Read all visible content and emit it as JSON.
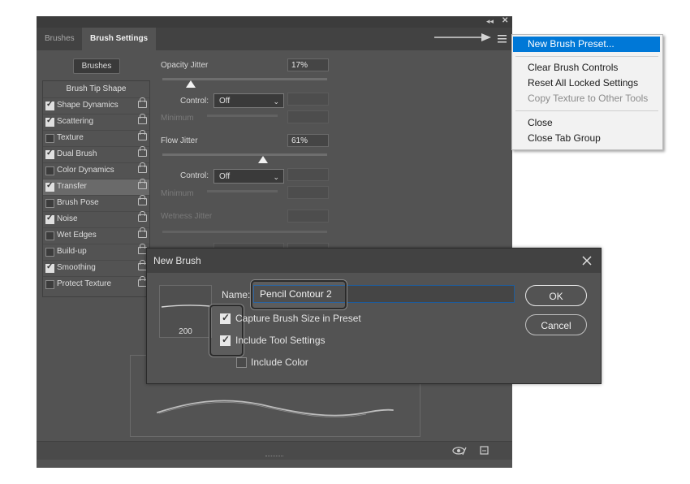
{
  "panel": {
    "tabs": [
      {
        "label": "Brushes"
      },
      {
        "label": "Brush Settings"
      }
    ],
    "brushes_button": "Brushes",
    "tip_shape_label": "Brush Tip Shape",
    "list_items": [
      {
        "label": "Shape Dynamics",
        "checked": true
      },
      {
        "label": "Scattering",
        "checked": true
      },
      {
        "label": "Texture",
        "checked": false
      },
      {
        "label": "Dual Brush",
        "checked": true
      },
      {
        "label": "Color Dynamics",
        "checked": false
      },
      {
        "label": "Transfer",
        "checked": true,
        "selected": true
      },
      {
        "label": "Brush Pose",
        "checked": false
      },
      {
        "label": "Noise",
        "checked": true
      },
      {
        "label": "Wet Edges",
        "checked": false
      },
      {
        "label": "Build-up",
        "checked": false
      },
      {
        "label": "Smoothing",
        "checked": true
      },
      {
        "label": "Protect Texture",
        "checked": false
      }
    ],
    "settings": {
      "opacity_jitter": {
        "label": "Opacity Jitter",
        "value": "17%",
        "level": 0.17
      },
      "control1": {
        "label": "Control:",
        "value": "Off"
      },
      "minimum1": "Minimum",
      "flow_jitter": {
        "label": "Flow Jitter",
        "value": "61%",
        "level": 0.61
      },
      "control2": {
        "label": "Control:",
        "value": "Off"
      },
      "minimum2": "Minimum",
      "wetness_jitter": "Wetness Jitter"
    },
    "icons": [
      "panel-collapse-icon",
      "panel-close-icon",
      "panel-menu-icon",
      "eye-toggle-icon",
      "new-preset-icon"
    ]
  },
  "menu": {
    "items": [
      {
        "label": "New Brush Preset...",
        "state": "highlighted"
      },
      {
        "label": "Clear Brush Controls",
        "state": "normal"
      },
      {
        "label": "Reset All Locked Settings",
        "state": "normal"
      },
      {
        "label": "Copy Texture to Other Tools",
        "state": "disabled"
      },
      {
        "label": "Close",
        "state": "normal"
      },
      {
        "label": "Close Tab Group",
        "state": "normal"
      }
    ]
  },
  "dialog": {
    "title": "New Brush",
    "name_label": "Name:",
    "name_value": "Pencil Contour 2",
    "brush_size": "200",
    "options": [
      {
        "label": "Capture Brush Size in Preset",
        "checked": true
      },
      {
        "label": "Include Tool Settings",
        "checked": true
      },
      {
        "label": "Include Color",
        "checked": false
      }
    ],
    "ok_label": "OK",
    "cancel_label": "Cancel"
  },
  "colors": {
    "panel_bg": "#535353",
    "menu_highlight": "#0078d7",
    "focus_border": "#1f5b99"
  }
}
